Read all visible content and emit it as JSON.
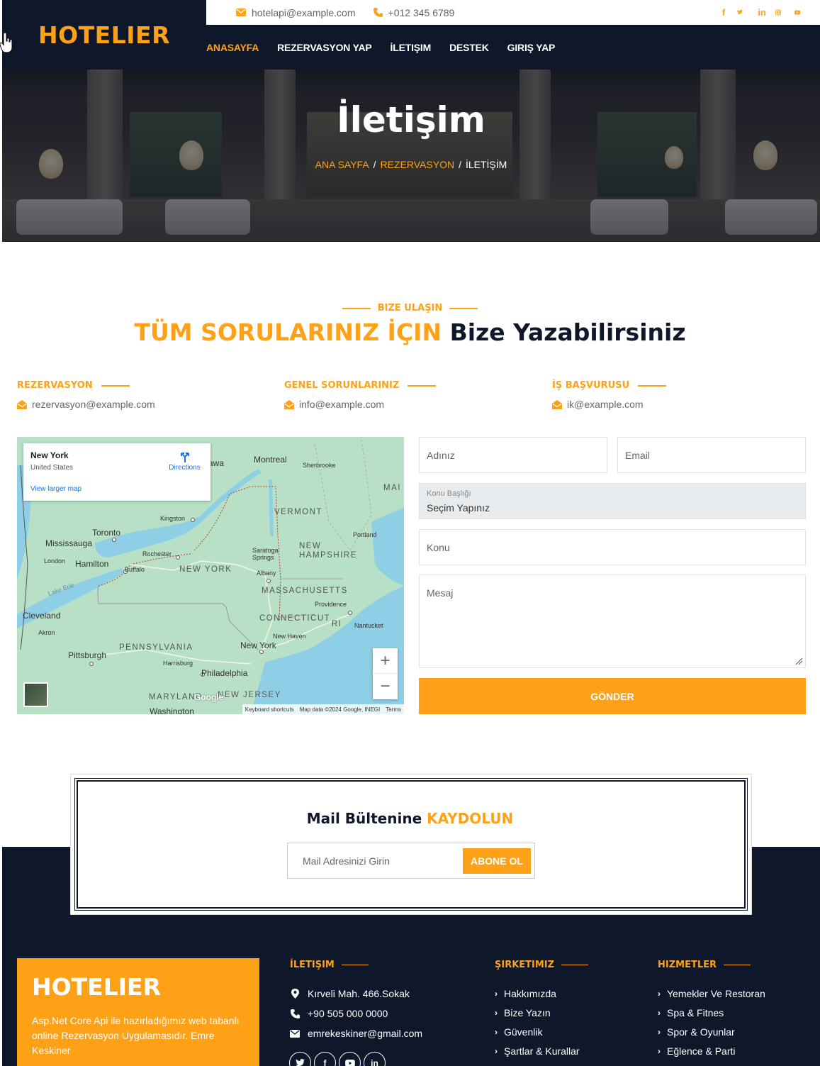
{
  "brand": {
    "logo": "HOTELIER"
  },
  "topbar": {
    "email": "hotelapi@example.com",
    "phone": "+012 345 6789",
    "socials": [
      "facebook-icon",
      "twitter-icon",
      "linkedin-icon",
      "instagram-icon",
      "youtube-icon"
    ]
  },
  "nav": {
    "items": [
      {
        "label": "ANASAYFA",
        "active": true
      },
      {
        "label": "REZERVASYON YAP",
        "active": false
      },
      {
        "label": "İLETIŞIM",
        "active": false
      },
      {
        "label": "DESTEK",
        "active": false
      },
      {
        "label": "GIRIŞ YAP",
        "active": false
      }
    ]
  },
  "hero": {
    "title": "İletişim",
    "breadcrumb": [
      "ANA SAYFA",
      "REZERVASYON",
      "İLETİŞİM"
    ]
  },
  "section": {
    "subtitle": "BIZE ULAŞIN",
    "title_highlight": "TÜM SORULARINIZ İÇIN",
    "title_rest": "Bize Yazabilirsiniz"
  },
  "contacts": [
    {
      "heading": "REZERVASYON",
      "email": "rezervasyon@example.com"
    },
    {
      "heading": "GENEL SORUNLARINIZ",
      "email": "info@example.com"
    },
    {
      "heading": "İŞ BAŞVURUSU",
      "email": "ik@example.com"
    }
  ],
  "map": {
    "place": "New York",
    "country": "United States",
    "directions": "Directions",
    "larger_map": "View larger map",
    "zoom_in": "+",
    "zoom_out": "−",
    "attribution": [
      "Keyboard shortcuts",
      "Map data ©2024 Google, INEGI",
      "Terms"
    ],
    "google": "Google",
    "labels": {
      "cities": [
        "Montreal",
        "Sherbrooke",
        "Toronto",
        "Mississauga",
        "Hamilton",
        "London",
        "Buffalo",
        "Rochester",
        "Kingston",
        "Albany",
        "Saratoga Springs",
        "Portland",
        "Providence",
        "Nantucket",
        "New Haven",
        "New York",
        "Cleveland",
        "Akron",
        "Pittsburgh",
        "Harrisburg",
        "Philadelphia",
        "Washington",
        "awa",
        "MAI",
        "Lake Erie"
      ],
      "states": [
        "VERMONT",
        "NEW HAMPSHIRE",
        "NEW YORK",
        "MASSACHUSETTS",
        "CONNECTICUT",
        "RI",
        "PENNSYLVANIA",
        "MARYLAND",
        "NEW JERSEY"
      ]
    }
  },
  "form": {
    "name_placeholder": "Adınız",
    "email_placeholder": "Email",
    "select_label": "Konu Başlığı",
    "select_value": "Seçim Yapınız",
    "subject_placeholder": "Konu",
    "message_placeholder": "Mesaj",
    "submit": "GÖNDER"
  },
  "newsletter": {
    "title": "Mail Bültenine",
    "title_highlight": "KAYDOLUN",
    "placeholder": "Mail Adresinizi Girin",
    "button": "ABONE OL"
  },
  "footer": {
    "logo": "HOTELIER",
    "description": "Asp.Net Core Api ile hazırladığımız web tabanlı online Rezervasyon Uygulamasıdır. Emre Keskiner",
    "contact": {
      "heading": "İLETIŞIM",
      "address": "Kırveli Mah. 466.Sokak",
      "phone": "+90 505 000 0000",
      "email": "emrekeskiner@gmail.com"
    },
    "company": {
      "heading": "ŞIRKETIMIZ",
      "links": [
        "Hakkımızda",
        "Bize Yazın",
        "Güvenlik",
        "Şartlar & Kurallar"
      ]
    },
    "services": {
      "heading": "HIZMETLER",
      "links": [
        "Yemekler Ve Restoran",
        "Spa & Fitnes",
        "Spor & Oyunlar",
        "Eğlence & Parti"
      ]
    },
    "socials": [
      "twitter-icon",
      "facebook-icon",
      "youtube-icon",
      "linkedin-icon"
    ]
  },
  "colors": {
    "primary": "#fea116",
    "dark": "#0f172b"
  }
}
